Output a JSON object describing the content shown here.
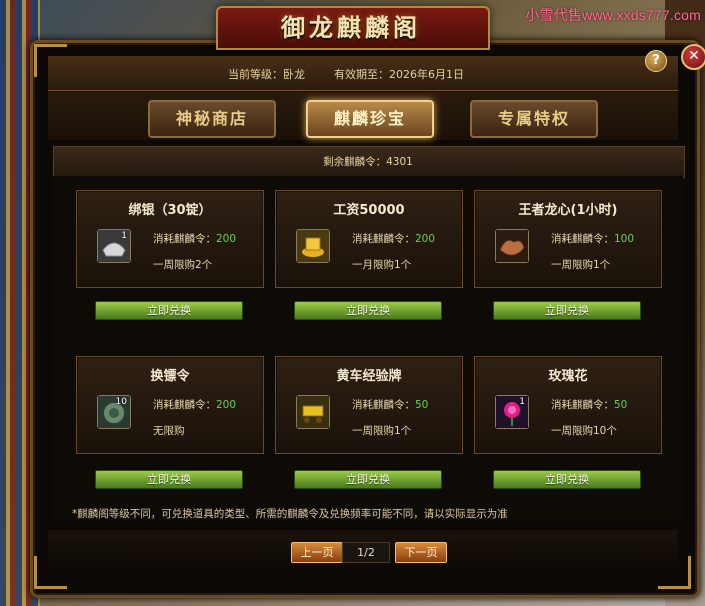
{
  "window": {
    "title": "御龙麒麟阁",
    "watermark": "小雪代售www.xxds777.com",
    "help_label": "?",
    "close_label": "✕"
  },
  "info": {
    "level_label": "当前等级：卧龙",
    "expiry_label": "有效期至：2026年6月1日"
  },
  "tabs": [
    {
      "label": "神秘商店",
      "active": false
    },
    {
      "label": "麒麟珍宝",
      "active": true
    },
    {
      "label": "专属特权",
      "active": false
    }
  ],
  "remaining": "剩余麒麟令：4301",
  "cost_label": "消耗麒麟令：",
  "exchange_label": "立即兑换",
  "items": [
    {
      "name": "绑银（30锭）",
      "qty": "1",
      "cost": "200",
      "limit": "一周限购2个",
      "icon": "silver-ingot-icon"
    },
    {
      "name": "工资50000",
      "qty": "",
      "cost": "200",
      "limit": "一月限购1个",
      "icon": "gold-salary-icon"
    },
    {
      "name": "王者龙心(1小时)",
      "qty": "",
      "cost": "100",
      "limit": "一周限购1个",
      "icon": "dragon-heart-icon"
    },
    {
      "name": "换镖令",
      "qty": "10",
      "cost": "200",
      "limit": "无限购",
      "icon": "escort-token-icon"
    },
    {
      "name": "黄车经验牌",
      "qty": "",
      "cost": "50",
      "limit": "一周限购1个",
      "icon": "yellow-cart-icon"
    },
    {
      "name": "玫瑰花",
      "qty": "1",
      "cost": "50",
      "limit": "一周限购10个",
      "icon": "rose-icon"
    }
  ],
  "note": "*麒麟阁等级不同，可兑换道具的类型、所需的麒麟令及兑换频率可能不同，请以实际显示为准",
  "pager": {
    "prev": "上一页",
    "page": "1/2",
    "next": "下一页"
  }
}
